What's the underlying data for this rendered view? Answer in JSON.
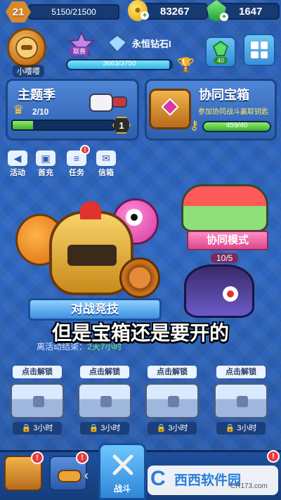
{
  "top_bar": {
    "level": "21",
    "xp": "5150/21500",
    "coins": "83267",
    "gems": "1647"
  },
  "profile": {
    "name": "小嘤嘤",
    "league_label": "联赛",
    "rank": "永恒钻石I",
    "trophies": "3663/3750",
    "trophy_progress": 0.977,
    "gem_reward": "40"
  },
  "season_panel": {
    "title": "主题季",
    "progress_text": "2/10",
    "progress": 0.2,
    "level": "1"
  },
  "coop_chest_panel": {
    "title": "协同宝箱",
    "description": "参加协同战斗赢取钥匙",
    "keys": "459/40",
    "progress": 1.0
  },
  "menu": [
    {
      "label": "活动",
      "icon": "megaphone-icon",
      "badge": ""
    },
    {
      "label": "首充",
      "icon": "gift-icon",
      "badge": ""
    },
    {
      "label": "任务",
      "icon": "scroll-icon",
      "badge": "!"
    },
    {
      "label": "信箱",
      "icon": "mail-icon",
      "badge": ""
    }
  ],
  "battle": {
    "banner": "对战竞技",
    "event_text": "离活动结束：",
    "event_time": "2天7小时"
  },
  "coop_mode": {
    "label": "协同模式",
    "count": "10/5"
  },
  "subtitle": "但是宝箱还是要开的",
  "chest_slots": [
    {
      "tag": "点击解锁",
      "timer": "3小时"
    },
    {
      "tag": "点击解锁",
      "timer": "3小时"
    },
    {
      "tag": "点击解锁",
      "timer": "3小时"
    },
    {
      "tag": "点击解锁",
      "timer": "3小时"
    }
  ],
  "bottom_nav": {
    "battle_label": "战斗"
  },
  "watermark": {
    "main": "西西软件园",
    "sub": "CR173.com"
  }
}
